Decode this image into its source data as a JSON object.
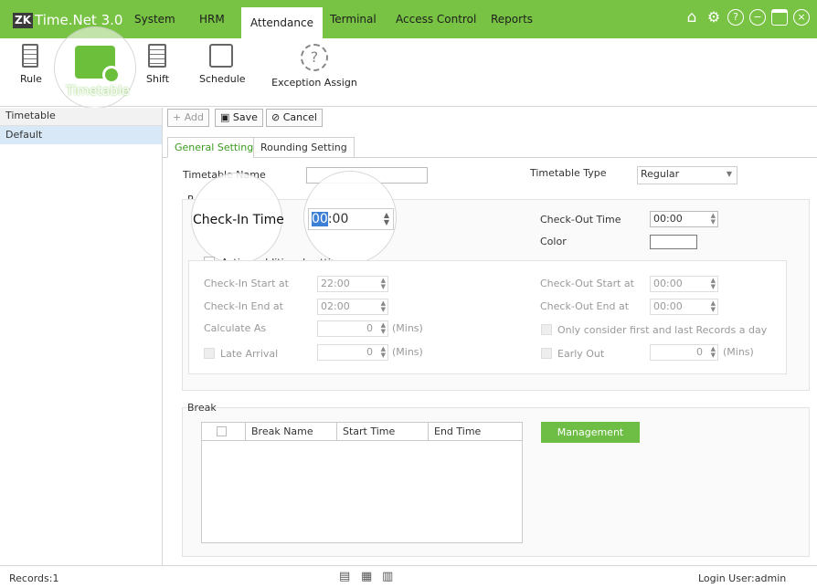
{
  "app": {
    "logo_badge": "ZK",
    "logo_text": "Time.Net 3.0"
  },
  "menu": {
    "items": [
      "System",
      "HRM",
      "Attendance",
      "Terminal",
      "Access Control",
      "Reports"
    ],
    "active": "Attendance"
  },
  "window_icons": [
    "home-icon",
    "gear-icon",
    "help-icon",
    "minimize-icon",
    "maximize-icon",
    "close-icon"
  ],
  "toolbar": {
    "rule": "Rule",
    "timetable": "Timetable",
    "shift": "Shift",
    "schedule": "Schedule",
    "exception_assign": "Exception Assign"
  },
  "left_panel": {
    "header": "Timetable",
    "items": [
      "Default"
    ]
  },
  "actions": {
    "add": "+ Add",
    "save": "Save",
    "cancel": "Cancel"
  },
  "tabs": [
    "General Setting",
    "Rounding Setting"
  ],
  "form": {
    "timetable_name_label": "Timetable Name",
    "timetable_name_value": "",
    "timetable_type_label": "Timetable Type",
    "timetable_type_value": "Regular",
    "section_label": "R",
    "check_in_time_label": "Check-In Time",
    "check_in_time_hour": "00",
    "check_in_time_rest": ":00",
    "check_out_time_label": "Check-Out Time",
    "check_out_time_value": "00:00",
    "color_label": "Color",
    "active_additional_label": "Active additional setting",
    "check_in_start_label": "Check-In Start at",
    "check_in_start_value": "22:00",
    "check_in_end_label": "Check-In End at",
    "check_in_end_value": "02:00",
    "calculate_as_label": "Calculate As",
    "calculate_as_value": "0",
    "late_arrival_label": "Late Arrival",
    "late_arrival_value": "0",
    "mins_label": "(Mins)",
    "check_out_start_label": "Check-Out Start at",
    "check_out_start_value": "00:00",
    "check_out_end_label": "Check-Out End at",
    "check_out_end_value": "00:00",
    "only_consider_label": "Only consider first and last Records a day",
    "early_out_label": "Early Out",
    "early_out_value": "0"
  },
  "break_section": {
    "label": "Break",
    "columns": [
      "Break Name",
      "Start Time",
      "End Time"
    ],
    "management_button": "Management"
  },
  "status": {
    "records": "Records:1",
    "login_user": "Login User:admin"
  }
}
